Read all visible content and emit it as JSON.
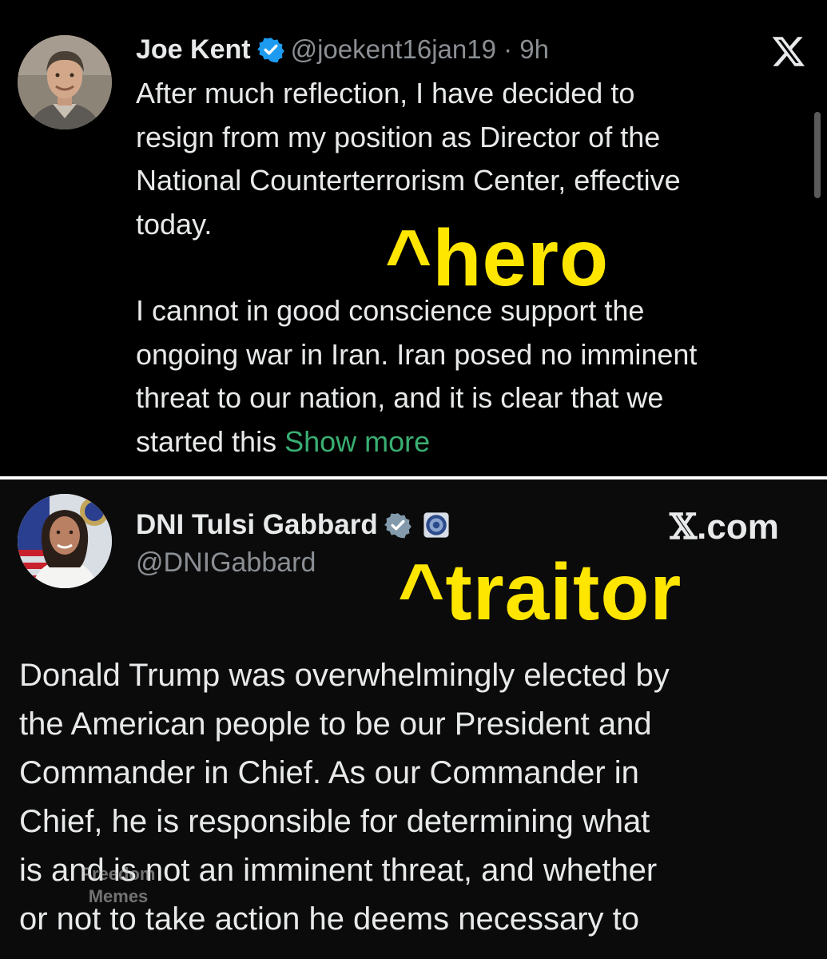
{
  "top_tweet": {
    "display_name": "Joe Kent",
    "handle_time": "@joekent16jan19 · 9h",
    "para1_lines": [
      "After much reflection, I have decided to",
      "resign from my position as Director of the",
      "National Counterterrorism Center, effective",
      "today."
    ],
    "para2_lines": [
      "I cannot in good conscience support the",
      "ongoing war in Iran. Iran posed no imminent",
      "threat to our nation, and it is clear that we"
    ],
    "para2_last_prefix": "started this ",
    "show_more": "Show more",
    "caption": "^hero",
    "platform_glyph": "𝕏"
  },
  "bottom_tweet": {
    "display_name": "DNI Tulsi Gabbard",
    "handle": "@DNIGabbard",
    "platform_label_glyph": "𝕏",
    "platform_label_suffix": ".com",
    "caption": "^traitor",
    "body_lines": [
      "Donald Trump was overwhelmingly elected by",
      "the American people to be our President and",
      "Commander in Chief. As our Commander in",
      "Chief, he is responsible for determining what",
      "is and is not an imminent threat, and whether",
      "or not to take action he deems necessary to"
    ]
  },
  "watermark": {
    "line1": "Freedom",
    "line2": "Memes"
  },
  "colors": {
    "background": "#000000",
    "text": "#e7e9ea",
    "muted": "#8b8f94",
    "verified_blue": "#1d9bf0",
    "gov_gray": "#829aab",
    "link_green": "#3aae72",
    "caption_yellow": "#ffe600"
  },
  "icons": {
    "verified": "verified-badge-icon",
    "gov_verified": "gray-verified-badge-icon",
    "agency": "agency-seal-icon",
    "platform": "x-logo-icon"
  }
}
